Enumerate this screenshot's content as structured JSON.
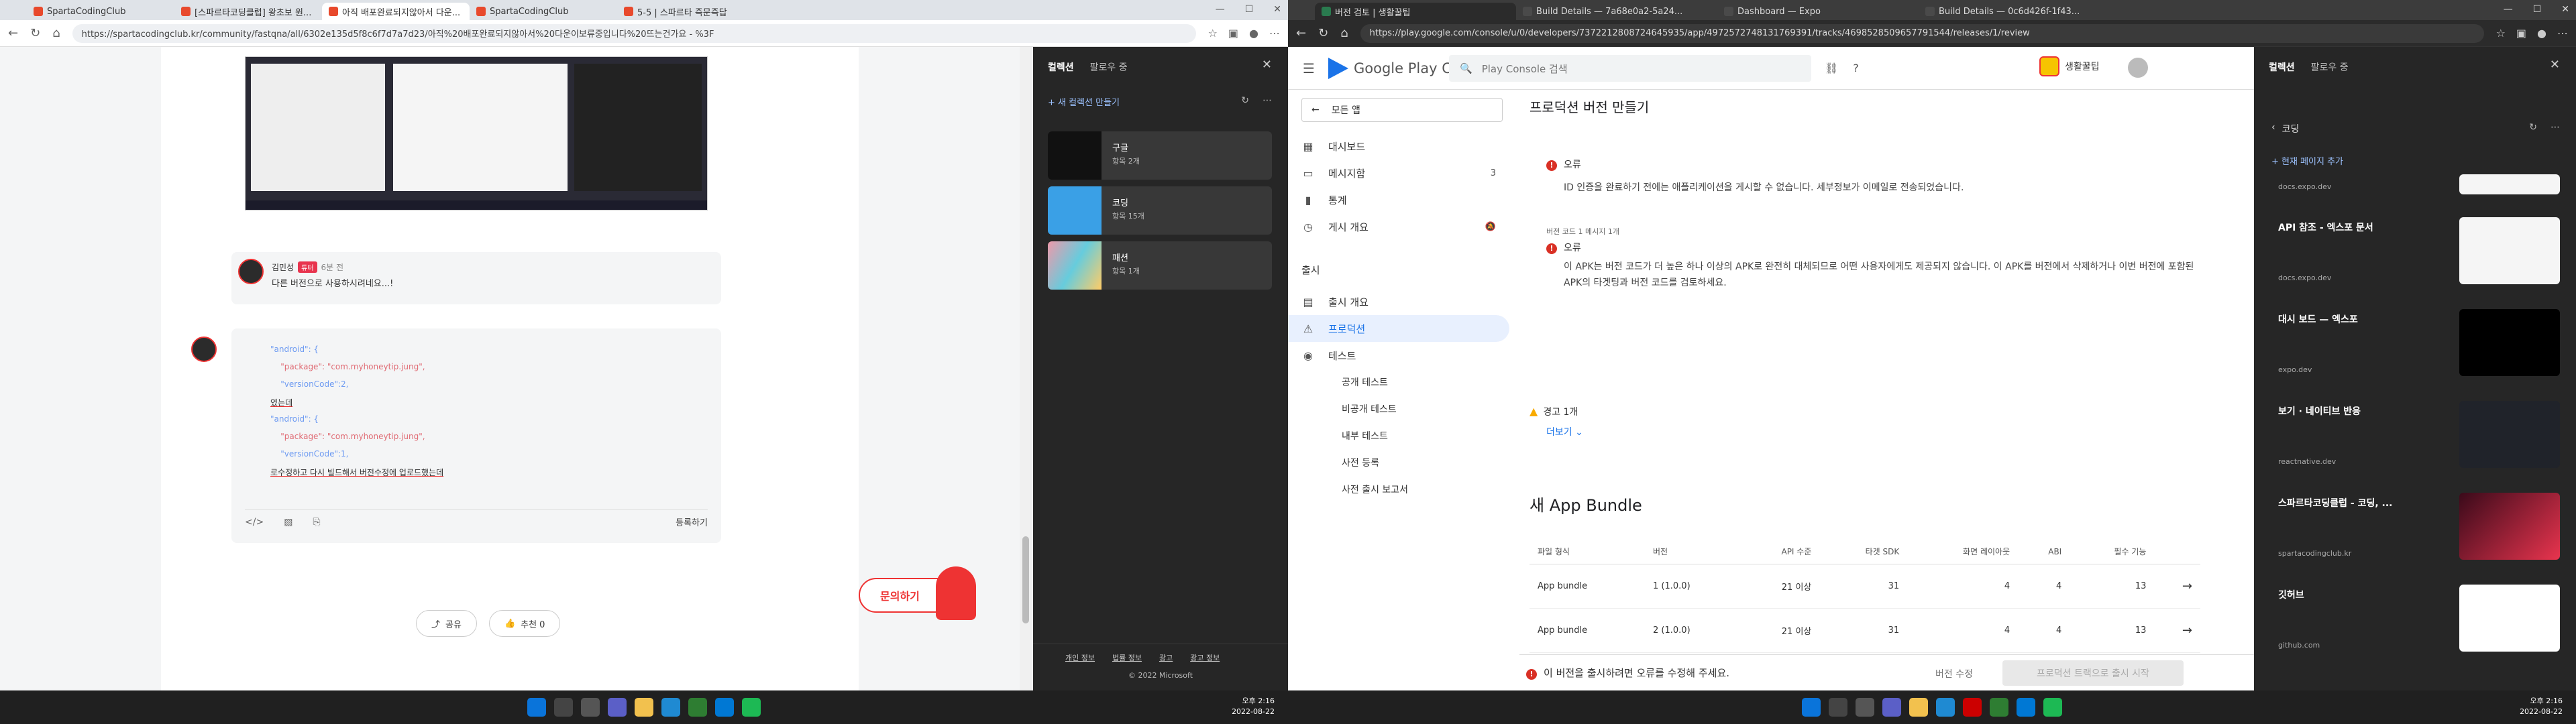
{
  "left_browser": {
    "tabs": [
      {
        "label": "SpartaCodingClub",
        "active": false
      },
      {
        "label": "[스파르타코딩클럽] 왕초보 원...",
        "active": false
      },
      {
        "label": "아직 배포완료되지않아서 다운...",
        "active": true
      },
      {
        "label": "SpartaCodingClub",
        "active": false
      },
      {
        "label": "5-5 | 스파르타 즉문즉답",
        "active": false
      }
    ],
    "url": "https://spartacodingclub.kr/community/fastqna/all/6302e135d5f8c6f7d7a7d23/아직%20배포완료되지않아서%20다운이보류중입니다%20뜨는건가요 - %3F",
    "comment1": {
      "author": "김민성",
      "badge": "튜터",
      "time": "6분 전",
      "text": "다른 버전으로 사용하시려네요...!"
    },
    "code_lines": [
      "\"android\": {",
      "    \"package\": \"com.myhoneytip.jung\",",
      "    \"versionCode\":2,",
      "였는데",
      "\"android\": {",
      "    \"package\": \"com.myhoneytip.jung\",",
      "    \"versionCode\":1,",
      "로수정하고 다시 빌드해서 버전수정에 업로드했는데"
    ],
    "editor_submit": "등록하기",
    "share_label": "공유",
    "like_label": "추천 0",
    "ask_label": "문의하기"
  },
  "left_panel": {
    "tab_collections": "컬렉션",
    "tab_follow": "팔로우 중",
    "new_collection": "새 컬렉션 만들기",
    "collections": [
      {
        "name": "구글",
        "count": "항목 2개"
      },
      {
        "name": "코딩",
        "count": "항목 15개"
      },
      {
        "name": "패션",
        "count": "항목 1개"
      }
    ],
    "footer_links": [
      "개인 정보",
      "법률 정보",
      "광고",
      "광고 정보"
    ],
    "copyright": "© 2022 Microsoft"
  },
  "right_browser": {
    "tabs": [
      {
        "label": "버전 검토 | 생활꿀팁",
        "active": true
      },
      {
        "label": "Build Details — 7a68e0a2-5a24...",
        "active": false
      },
      {
        "label": "Dashboard — Expo",
        "active": false
      },
      {
        "label": "Build Details — 0c6d426f-1f43...",
        "active": false
      }
    ],
    "url": "https://play.google.com/console/u/0/developers/7372212808724645935/app/4972572748131769391/tracks/4698528509657791544/releases/1/review"
  },
  "play_console": {
    "logo": "Google Play Console",
    "search_placeholder": "Play Console 검색",
    "app_name": "생활꿀팁",
    "all_apps": "모든 앱",
    "nav": [
      {
        "label": "대시보드",
        "icon": "dashboard-icon"
      },
      {
        "label": "메시지함",
        "icon": "inbox-icon",
        "badge": "3"
      },
      {
        "label": "통계",
        "icon": "stats-icon"
      },
      {
        "label": "게시 개요",
        "icon": "publishing-icon"
      }
    ],
    "release_section": "출시",
    "release_nav": [
      {
        "label": "출시 개요"
      },
      {
        "label": "프로덕션",
        "active": true
      },
      {
        "label": "테스트"
      },
      {
        "label": "공개 테스트",
        "sub": true
      },
      {
        "label": "비공개 테스트",
        "sub": true
      },
      {
        "label": "내부 테스트",
        "sub": true
      },
      {
        "label": "사전 등록",
        "sub": true
      },
      {
        "label": "사전 출시 보고서",
        "sub": true
      }
    ],
    "page_title": "프로덕션 버전 만들기",
    "error1_title": "오류",
    "error1_text": "ID 인증을 완료하기 전에는 애플리케이션을 게시할 수 없습니다. 세부정보가 이메일로 전송되었습니다.",
    "error2_meta": "버전 코드 1 메시지 1개",
    "error2_title": "오류",
    "error2_text": "이 APK는 버전 코드가 더 높은 하나 이상의 APK로 완전히 대체되므로 어떤 사용자에게도 제공되지 않습니다. 이 APK를 버전에서 삭제하거나 이번 버전에 포함된 APK의 타겟팅과 버전 코드를 검토하세요.",
    "warning": "경고 1개",
    "more": "더보기",
    "bundle_title": "새 App Bundle",
    "table_headers": [
      "파일 형식",
      "버전",
      "API 수준",
      "타겟 SDK",
      "화면 레이아웃",
      "ABI",
      "필수 기능"
    ],
    "rows": [
      [
        "App bundle",
        "1 (1.0.0)",
        "21 이상",
        "31",
        "4",
        "4",
        "13"
      ],
      [
        "App bundle",
        "2 (1.0.0)",
        "21 이상",
        "31",
        "4",
        "4",
        "13"
      ]
    ],
    "bottom_error": "이 버전을 출시하려면 오류를 수정해 주세요.",
    "edit_version": "버전 수정",
    "save_button": "프로덕션 트랙으로 출시 시작"
  },
  "right_panel": {
    "tab_collections": "컬렉션",
    "tab_follow": "팔로우 중",
    "back_title": "코딩",
    "add_page": "현재 페이지 추가",
    "items": [
      {
        "title": "",
        "site": "docs.expo.dev"
      },
      {
        "title": "API 참조 - 엑스포 문서",
        "site": "docs.expo.dev"
      },
      {
        "title": "대시 보드 — 엑스포",
        "site": "expo.dev"
      },
      {
        "title": "보기 · 네이티브 반응",
        "site": "reactnative.dev"
      },
      {
        "title": "스파르타코딩클럽 - 코딩, ...",
        "site": "spartacodingclub.kr"
      },
      {
        "title": "깃허브",
        "site": "github.com"
      }
    ]
  },
  "taskbar": {
    "time": "오후 2:16",
    "date": "2022-08-22"
  },
  "colors": {
    "accent": "#1a73e8",
    "error": "#d93025",
    "brand": "#e8344e"
  }
}
